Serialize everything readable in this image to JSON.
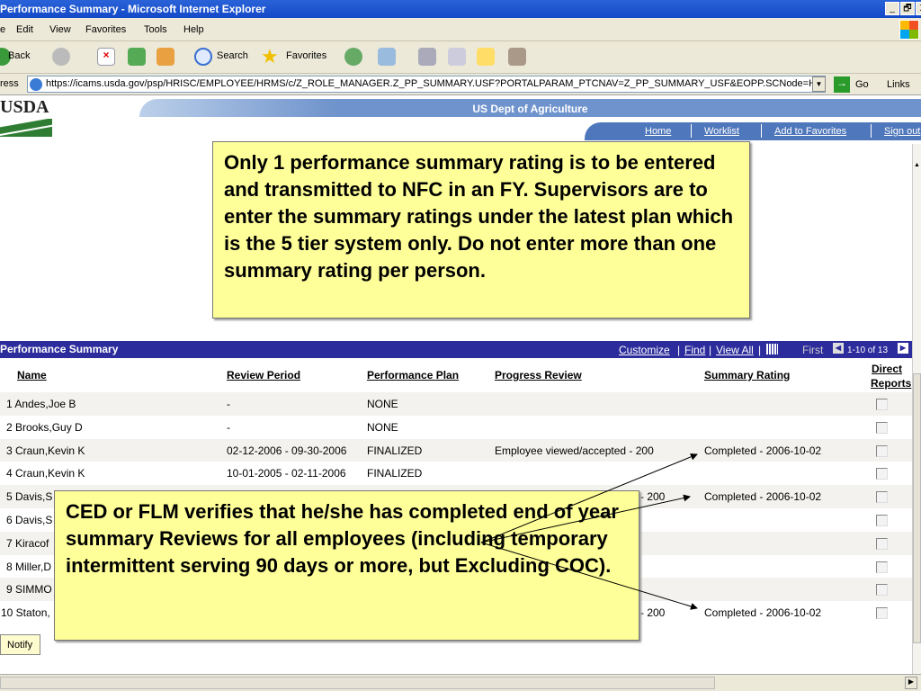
{
  "window": {
    "title": "Performance Summary - Microsoft Internet Explorer",
    "controls": [
      "_",
      "🗗",
      "X"
    ]
  },
  "menu": [
    "e",
    "Edit",
    "View",
    "Favorites",
    "Tools",
    "Help"
  ],
  "toolbar": {
    "back": "Back",
    "search": "Search",
    "favorites": "Favorites"
  },
  "address": {
    "label": "ress",
    "url": "https://icams.usda.gov/psp/HRISC/EMPLOYEE/HRMS/c/Z_ROLE_MANAGER.Z_PP_SUMMARY.USF?PORTALPARAM_PTCNAV=Z_PP_SUMMARY_USF&EOPP.SCNode=HR",
    "go": "Go",
    "links": "Links"
  },
  "header": {
    "logo": "USDA",
    "agency": "US Dept of Agriculture",
    "links": [
      "Home",
      "Worklist",
      "Add to Favorites",
      "Sign out"
    ]
  },
  "callout1": "Only 1 performance summary rating is to be entered and transmitted to NFC in an FY. Supervisors are to enter the summary ratings under the latest plan which is the 5 tier system only.   Do not enter more than one summary rating per person.",
  "callout2": "CED or FLM verifies that he/she has completed end of year summary Reviews for all employees (including temporary intermittent serving 90 days or more, but Excluding COC).",
  "grid": {
    "title": "Performance Summary",
    "customize": "Customize",
    "find": "Find",
    "view_all": "View All",
    "first": "First",
    "range": "1-10 of 13",
    "columns": [
      "Name",
      "Review Period",
      "Performance Plan",
      "Progress Review",
      "Summary Rating",
      "Direct",
      "Reports"
    ],
    "rows": [
      {
        "name": "1 Andes,Joe B",
        "period": "-",
        "plan": "NONE",
        "progress": "",
        "rating": ""
      },
      {
        "name": "2 Brooks,Guy D",
        "period": "-",
        "plan": "NONE",
        "progress": "",
        "rating": ""
      },
      {
        "name": "3 Craun,Kevin K",
        "period": "02-12-2006 - 09-30-2006",
        "plan": "FINALIZED",
        "progress": "Employee viewed/accepted - 200",
        "rating": "Completed - 2006-10-02"
      },
      {
        "name": "4 Craun,Kevin K",
        "period": "10-01-2005 - 02-11-2006",
        "plan": "FINALIZED",
        "progress": "",
        "rating": ""
      },
      {
        "name": "5 Davis,S",
        "period": "",
        "plan": "",
        "progress": "- 200",
        "rating": "Completed - 2006-10-02"
      },
      {
        "name": "6 Davis,S",
        "period": "",
        "plan": "",
        "progress": "",
        "rating": ""
      },
      {
        "name": "7 Kiracof",
        "period": "",
        "plan": "",
        "progress": "",
        "rating": ""
      },
      {
        "name": "8 Miller,D",
        "period": "",
        "plan": "",
        "progress": "",
        "rating": ""
      },
      {
        "name": "9 SIMMO",
        "period": "",
        "plan": "",
        "progress": "",
        "rating": ""
      },
      {
        "name": "10 Staton,",
        "period": "",
        "plan": "",
        "progress": "- 200",
        "rating": "Completed - 2006-10-02"
      }
    ]
  },
  "notify": "Notify"
}
